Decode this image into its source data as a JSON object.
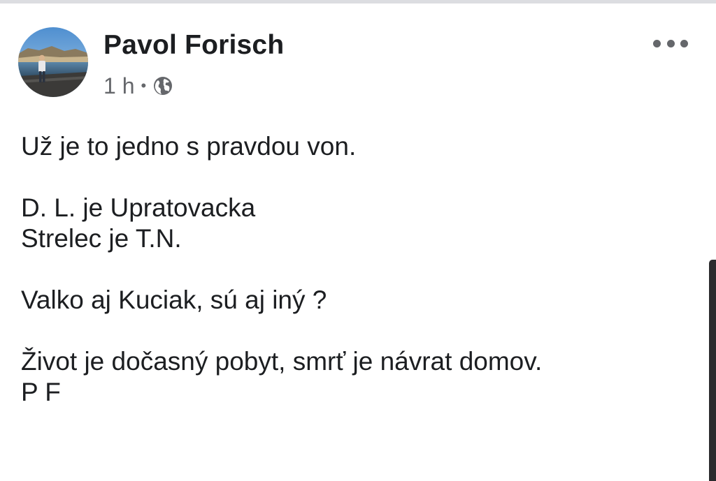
{
  "post": {
    "author": "Pavol Forisch",
    "timestamp": "1 h",
    "separator": "•",
    "privacy_icon": "globe-icon",
    "more_icon": "more-horizontal-icon",
    "lines": [
      "Už je to jedno s pravdou von.",
      "",
      "D. L. je Upratovacka",
      "Strelec je T.N.",
      "",
      "Valko aj Kuciak, sú aj iný ?",
      "",
      "Život je dočasný pobyt, smrť je návrat domov.",
      "P F"
    ]
  },
  "colors": {
    "text": "#1c1e21",
    "secondary_text": "#65676b",
    "background": "#ffffff"
  }
}
